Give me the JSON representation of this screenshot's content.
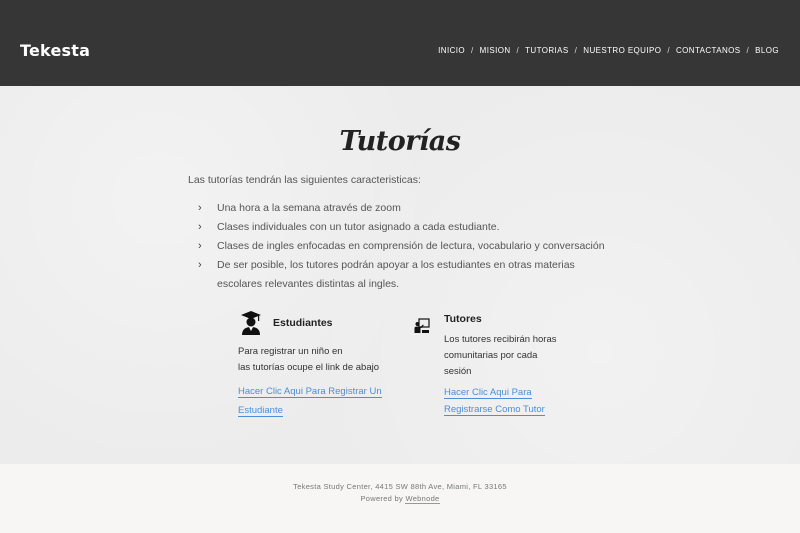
{
  "header": {
    "logo": "Tekesta",
    "nav": [
      "INICIO",
      "MISION",
      "TUTORIAS",
      "NUESTRO EQUIPO",
      "CONTACTANOS",
      "BLOG"
    ],
    "separator": "/"
  },
  "main": {
    "title": "Tutorías",
    "intro": "Las tutorías tendrán las siguientes caracteristicas:",
    "features": [
      "Una hora a la semana através de zoom",
      "Clases individuales con un tutor asignado a cada estudiante.",
      "Clases de ingles enfocadas en comprensión de lectura, vocabulario y conversación",
      "De ser posible, los tutores podrán apoyar a los estudiantes en otras materias escolares relevantes distintas al ingles."
    ],
    "bullet": "›",
    "students": {
      "icon": "student-graduate-icon",
      "title": "Estudiantes",
      "text_line1": "Para registrar un niño en",
      "text_line2": "las tutorías ocupe el link de abajo",
      "link_line1": "Hacer Clic Aqui Para Registrar Un",
      "link_line2": "Estudiante"
    },
    "tutors": {
      "icon": "teacher-board-icon",
      "title": "Tutores",
      "text_line1": "Los tutores recibirán horas",
      "text_line2": "comunitarias por cada",
      "text_line3": "sesión",
      "link_line1": "Hacer Clic Aqui Para",
      "link_line2": "Registrarse Como Tutor"
    }
  },
  "footer": {
    "address": "Tekesta Study Center, 4415 SW 88th Ave, Miami, FL 33165",
    "powered_prefix": "Powered by ",
    "powered_link": "Webnode"
  },
  "colors": {
    "header_bg": "#363636",
    "body_bg": "#ececec",
    "link": "#4a8fd8",
    "footer_bg": "#f7f6f5"
  }
}
